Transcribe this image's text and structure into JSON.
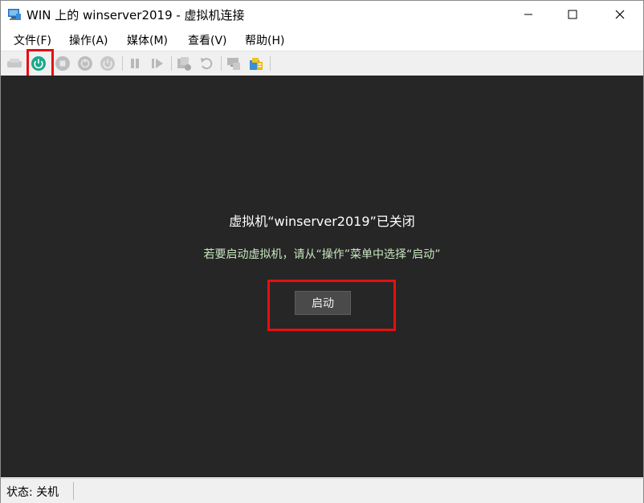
{
  "window": {
    "title": "WIN 上的 winserver2019 - 虚拟机连接"
  },
  "menu": {
    "items": [
      "文件(F)",
      "操作(A)",
      "媒体(M)",
      "查看(V)",
      "帮助(H)"
    ]
  },
  "toolbar": {
    "buttons": [
      {
        "icon": "ctrl-alt-del-icon",
        "enabled": false
      },
      {
        "icon": "start-power-icon",
        "enabled": true,
        "highlighted": true
      },
      {
        "icon": "turn-off-icon",
        "enabled": false
      },
      {
        "icon": "shutdown-icon",
        "enabled": false
      },
      {
        "icon": "save-state-icon",
        "enabled": false
      },
      {
        "icon": "pause-icon",
        "enabled": false
      },
      {
        "icon": "resume-icon",
        "enabled": false
      },
      {
        "icon": "checkpoint-icon",
        "enabled": false
      },
      {
        "icon": "revert-icon",
        "enabled": false
      },
      {
        "icon": "enhanced-session-icon",
        "enabled": false
      },
      {
        "icon": "share-icon",
        "enabled": true
      }
    ]
  },
  "screen": {
    "title": "虚拟机“winserver2019”已关闭",
    "hint": "若要启动虚拟机，请从“操作”菜单中选择“启动”",
    "start_button": "启动"
  },
  "status": {
    "text": "状态: 关机"
  },
  "colors": {
    "screen_bg": "#262626",
    "highlight": "#e4100f",
    "hint_text": "#c8e6bf"
  }
}
